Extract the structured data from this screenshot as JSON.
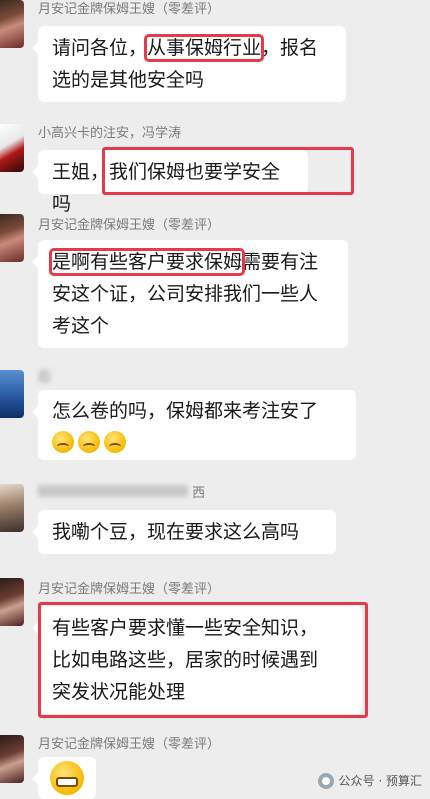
{
  "messages": [
    {
      "sender": "月安记金牌保姆王嫂（零差评）",
      "lines": [
        {
          "pre": "请问各位，",
          "highlight": "从事保姆行业",
          "post": "，报名"
        },
        {
          "pre": "选的是其他安全吗",
          "highlight": "",
          "post": ""
        }
      ]
    },
    {
      "sender": "小高兴卡的注安，冯学涛",
      "lines": [
        {
          "pre": "王姐，",
          "highlight": "我们保姆也要学安全吗",
          "post": ""
        }
      ]
    },
    {
      "sender": "月安记金牌保姆王嫂（零差评）",
      "lines": [
        {
          "pre": "",
          "highlight": "是啊有些客户要求保姆",
          "post": "需要有注"
        },
        {
          "pre": "安这个证，公司安排我们一些人",
          "highlight": "",
          "post": ""
        },
        {
          "pre": "考这个",
          "highlight": "",
          "post": ""
        }
      ]
    },
    {
      "sender": "后",
      "lines": [
        {
          "pre": "怎么卷的吗，保姆都来考注安了",
          "highlight": "",
          "post": ""
        }
      ],
      "emojis": [
        "crying-face-icon",
        "crying-face-icon",
        "crying-face-icon"
      ]
    },
    {
      "sender": "西",
      "lines": [
        {
          "pre": "我嘞个豆，现在要求这么高吗",
          "highlight": "",
          "post": ""
        }
      ]
    },
    {
      "sender": "月安记金牌保姆王嫂（零差评）",
      "lines": [
        {
          "pre": "有些客户要求懂一些安全知识，",
          "highlight": "",
          "post": ""
        },
        {
          "pre": "比如电路这些，居家的时候遇到",
          "highlight": "",
          "post": ""
        },
        {
          "pre": "突发状况能处理",
          "highlight": "",
          "post": ""
        }
      ]
    },
    {
      "sender": "月安记金牌保姆王嫂（零差评）",
      "emojis": [
        "grinning-face-icon"
      ]
    }
  ],
  "watermark": {
    "text": "公众号 · 预算汇",
    "icon": "wechat-official-account-icon"
  },
  "colors": {
    "background": "#ededed",
    "bubble": "#ffffff",
    "highlight": "#e6394a",
    "sender_name": "#7a7a7a"
  }
}
